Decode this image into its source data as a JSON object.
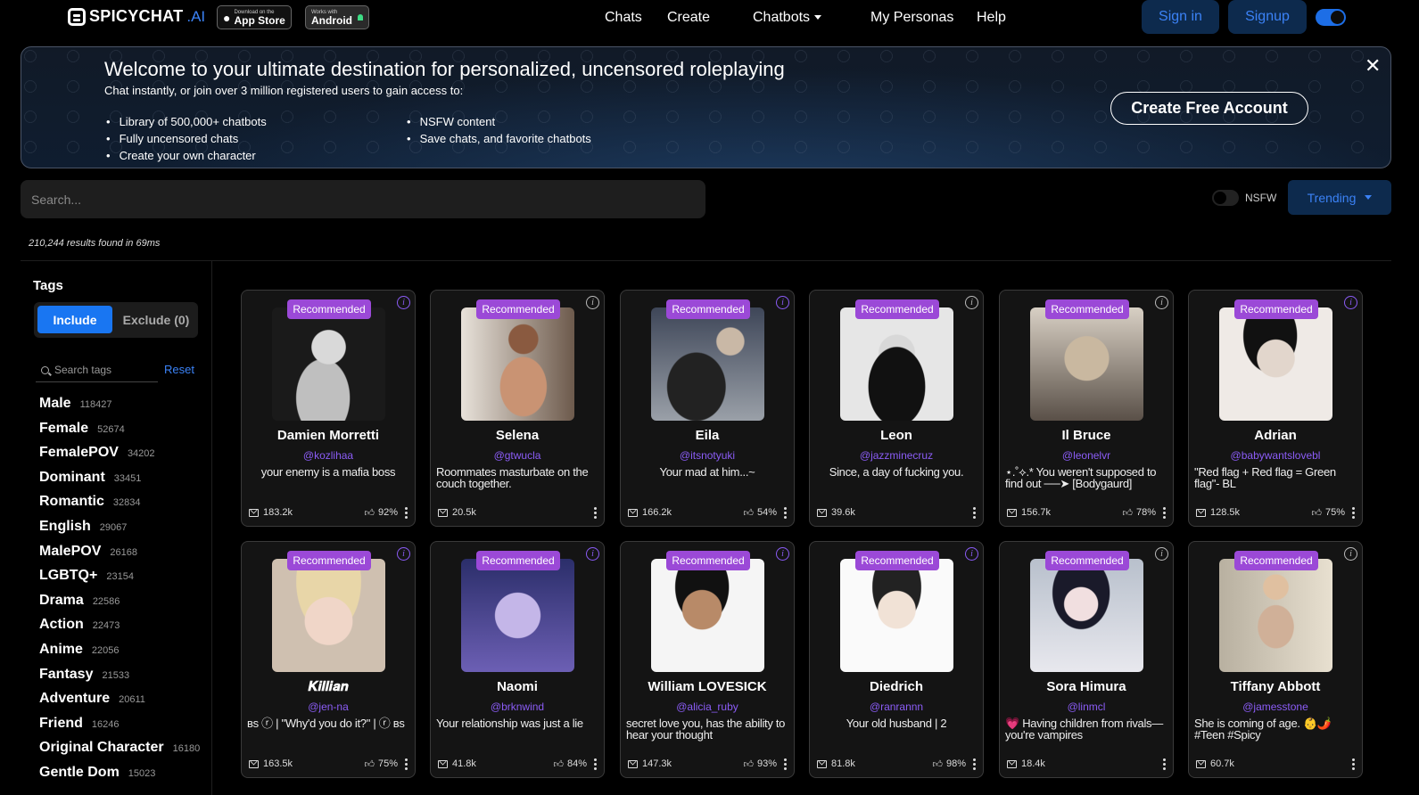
{
  "header": {
    "logo_text": "SPICYCHAT",
    "logo_suffix": ".AI",
    "app_store_small": "Download on the",
    "app_store_big": "App Store",
    "android_small": "Works with",
    "android_big": "Android",
    "nav": {
      "chats": "Chats",
      "create": "Create",
      "chatbots": "Chatbots",
      "personas": "My Personas",
      "help": "Help"
    },
    "signin": "Sign in",
    "signup": "Signup"
  },
  "banner": {
    "title": "Welcome to your ultimate destination for personalized, uncensored roleplaying",
    "subtitle": "Chat instantly, or join over 3 million registered users to gain access to:",
    "list_left": [
      "Library of 500,000+ chatbots",
      "Fully uncensored chats",
      "Create your own character"
    ],
    "list_right": [
      "NSFW content",
      "Save chats, and favorite chatbots"
    ],
    "cta": "Create Free Account",
    "close": "✕"
  },
  "search": {
    "placeholder": "Search...",
    "nsfw_label": "NSFW",
    "sort_label": "Trending",
    "results": "210,244 results found in 69ms"
  },
  "sidebar": {
    "heading": "Tags",
    "include": "Include",
    "exclude": "Exclude (0)",
    "tag_search_placeholder": "Search tags",
    "reset": "Reset",
    "tags": [
      {
        "name": "Male",
        "count": "118427"
      },
      {
        "name": "Female",
        "count": "52674"
      },
      {
        "name": "FemalePOV",
        "count": "34202"
      },
      {
        "name": "Dominant",
        "count": "33451"
      },
      {
        "name": "Romantic",
        "count": "32834"
      },
      {
        "name": "English",
        "count": "29067"
      },
      {
        "name": "MalePOV",
        "count": "26168"
      },
      {
        "name": "LGBTQ+",
        "count": "23154"
      },
      {
        "name": "Drama",
        "count": "22586"
      },
      {
        "name": "Action",
        "count": "22473"
      },
      {
        "name": "Anime",
        "count": "22056"
      },
      {
        "name": "Fantasy",
        "count": "21533"
      },
      {
        "name": "Adventure",
        "count": "20611"
      },
      {
        "name": "Friend",
        "count": "16246"
      },
      {
        "name": "Original Character",
        "count": "16180"
      },
      {
        "name": "Gentle Dom",
        "count": "15023"
      }
    ]
  },
  "cards": [
    {
      "badge": "Recommended",
      "name": "Damien Morretti",
      "handle": "@kozlihaa",
      "desc": "your enemy is a mafia boss",
      "chats": "183.2k",
      "rating": "92%",
      "info_purple": true
    },
    {
      "badge": "Recommended",
      "name": "Selena",
      "handle": "@gtwucla",
      "desc": "Roommates masturbate on the couch together.",
      "chats": "20.5k",
      "rating": "",
      "info_purple": false
    },
    {
      "badge": "Recommended",
      "name": "Eila",
      "handle": "@itsnotyuki",
      "desc": "Your mad at him...~",
      "chats": "166.2k",
      "rating": "54%",
      "info_purple": true
    },
    {
      "badge": "Recommended",
      "name": "Leon",
      "handle": "@jazzminecruz",
      "desc": "Since, a day of fucking you.",
      "chats": "39.6k",
      "rating": "",
      "info_purple": false
    },
    {
      "badge": "Recommended",
      "name": "Il Bruce",
      "handle": "@leonelvr",
      "desc": "⋆.˚⟡.* You weren't supposed to find out ──➤ [Bodygaurd]",
      "chats": "156.7k",
      "rating": "78%",
      "info_purple": false
    },
    {
      "badge": "Recommended",
      "name": "Adrian",
      "handle": "@babywantslovebl",
      "desc": "\"Red flag + Red flag = Green flag\"- BL",
      "chats": "128.5k",
      "rating": "75%",
      "info_purple": true
    },
    {
      "badge": "Recommended",
      "name": "𝑲𝒊𝒍𝒍𝒊𝒂𝒏",
      "handle": "@jen-na",
      "desc": "ʙs ⓡ | \"Why'd you do it?\" | ⓡ ʙs",
      "chats": "163.5k",
      "rating": "75%",
      "info_purple": true
    },
    {
      "badge": "Recommended",
      "name": "Naomi",
      "handle": "@brknwind",
      "desc": "Your relationship was just a lie",
      "chats": "41.8k",
      "rating": "84%",
      "info_purple": true
    },
    {
      "badge": "Recommended",
      "name": "William LOVESICK",
      "handle": "@alicia_ruby",
      "desc": "secret love you, has the ability to hear your thought",
      "chats": "147.3k",
      "rating": "93%",
      "info_purple": true
    },
    {
      "badge": "Recommended",
      "name": "Diedrich",
      "handle": "@ranrannn",
      "desc": "Your old husband | 2",
      "chats": "81.8k",
      "rating": "98%",
      "info_purple": true
    },
    {
      "badge": "Recommended",
      "name": "Sora Himura",
      "handle": "@linmcl",
      "desc": "💗 Having children from rivals— you're vampires",
      "chats": "18.4k",
      "rating": "",
      "info_purple": false
    },
    {
      "badge": "Recommended",
      "name": "Tiffany Abbott",
      "handle": "@jamesstone",
      "desc": "She is coming of age. 👶🌶️ #Teen #Spicy",
      "chats": "60.7k",
      "rating": "",
      "info_purple": false
    }
  ],
  "colors": {
    "accent": "#3b82f6",
    "badge": "#9b49d7",
    "handle": "#8b5cf6",
    "include": "#1976f2"
  }
}
